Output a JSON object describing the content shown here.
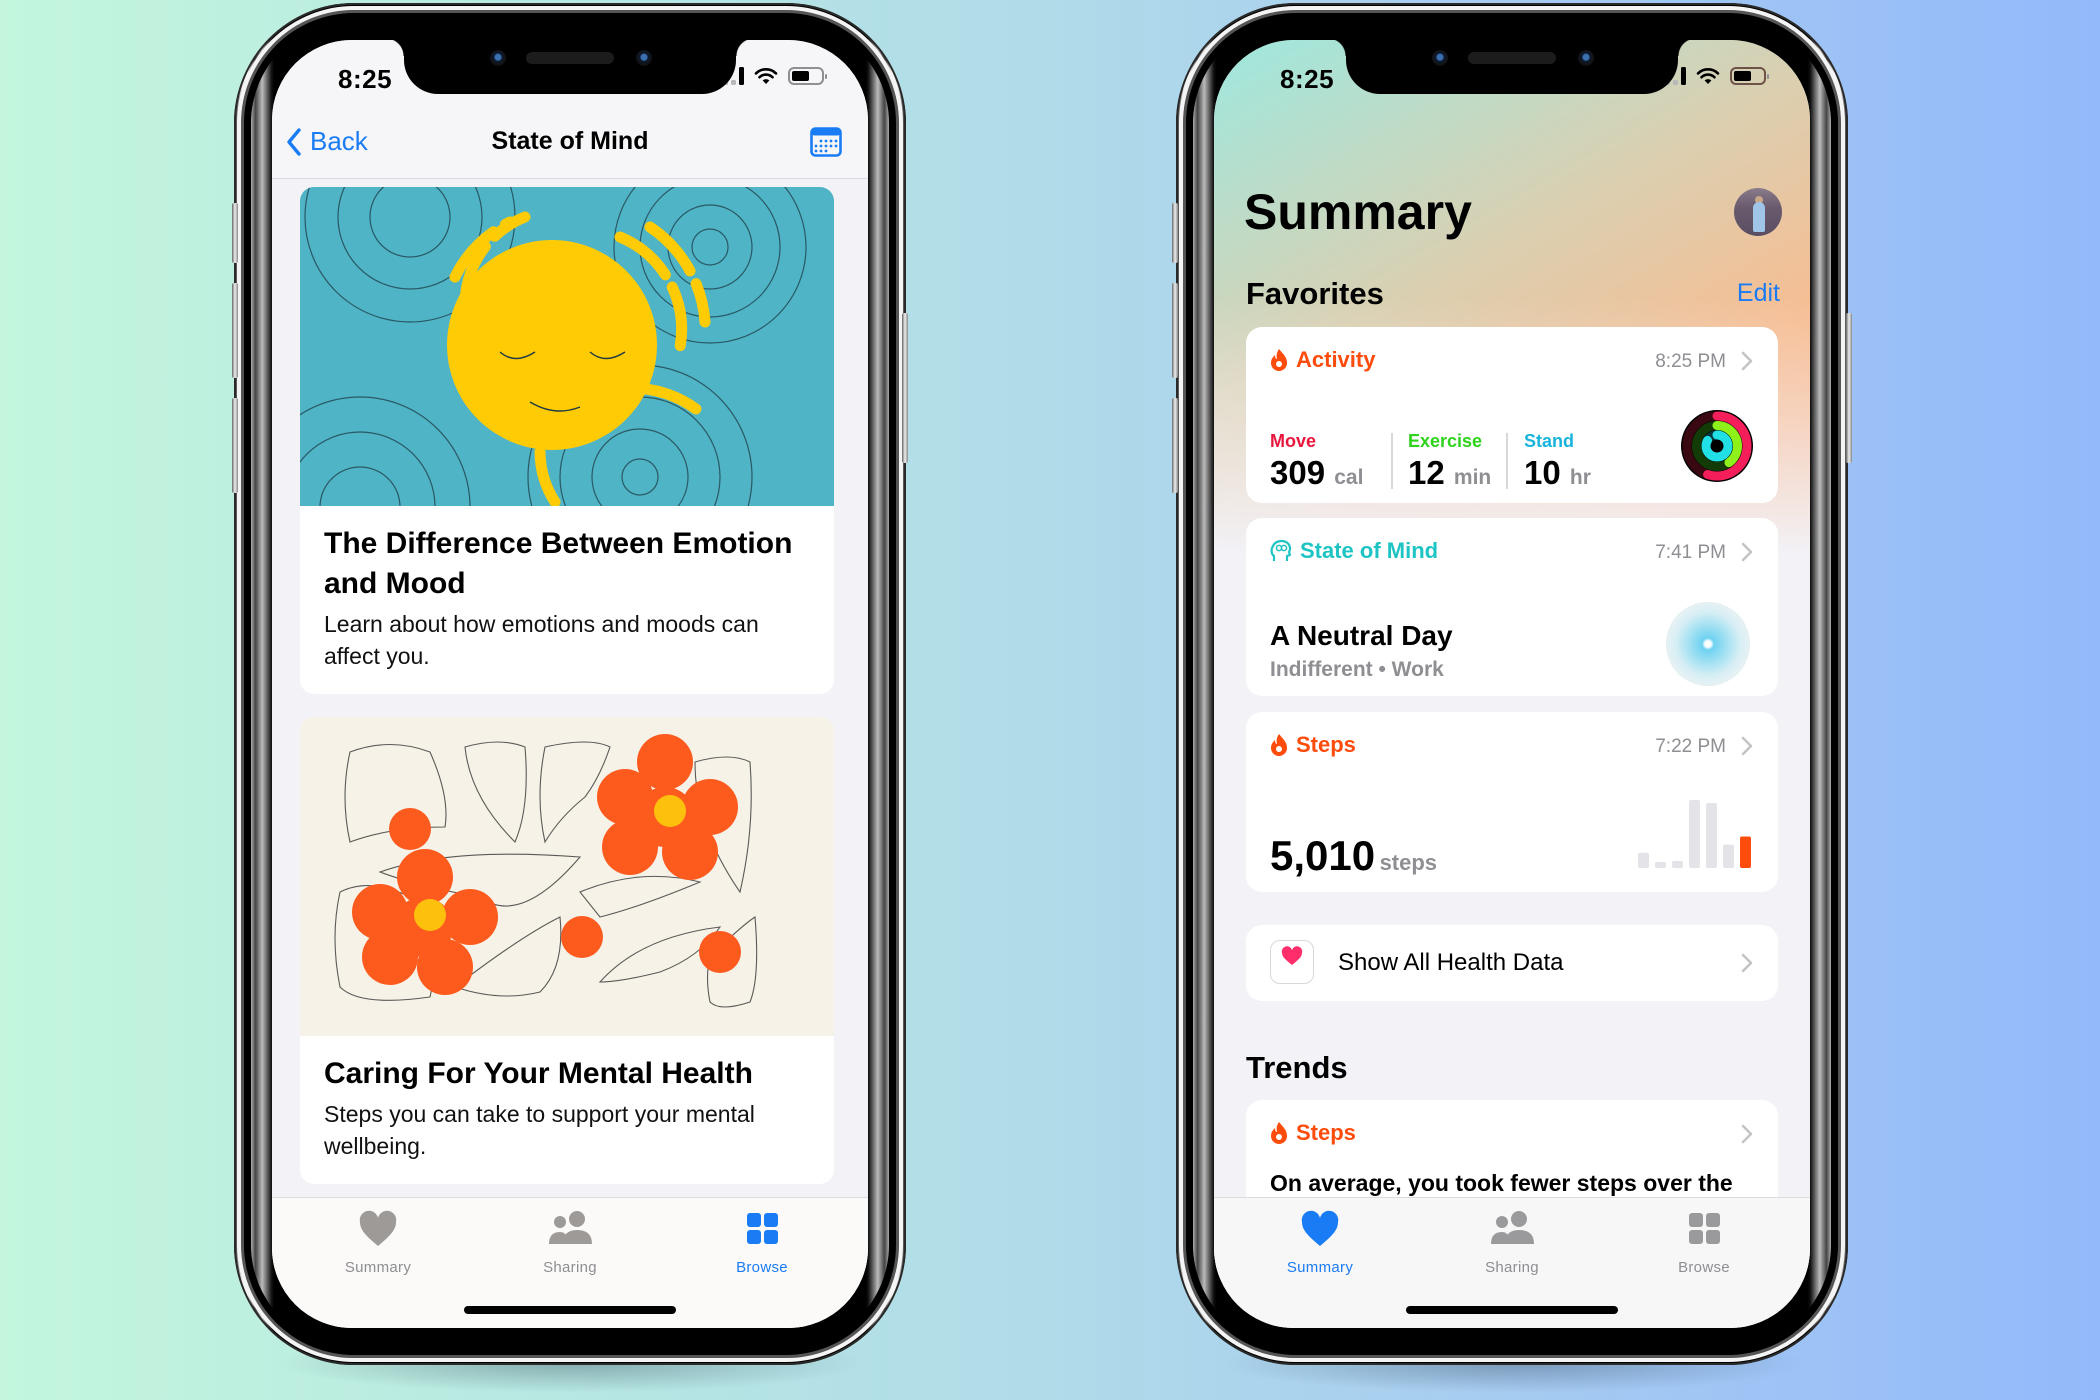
{
  "colors": {
    "accent_blue": "#1a7cf5",
    "activity_orange": "#fd4c0c",
    "move_red": "#e8163c",
    "exercise_green": "#2ed31c",
    "stand_cyan": "#19b4dc",
    "mind_teal": "#1ec4c4",
    "tab_gray": "#8e8e93"
  },
  "left_phone": {
    "status": {
      "time": "8:25",
      "signal_icon": "cellular-signal-icon",
      "wifi_icon": "wifi-icon",
      "battery_icon": "battery-icon",
      "battery_level": 0.6
    },
    "nav": {
      "back_label": "Back",
      "title": "State of Mind",
      "calendar_icon": "calendar-icon"
    },
    "articles": [
      {
        "title": "The Difference Between Emotion and Mood",
        "description": "Learn about how emotions and moods can affect you.",
        "illustration": "sleeping-sun-ripples-illustration"
      },
      {
        "title": "Caring For Your Mental Health",
        "description": "Steps you can take to support your mental wellbeing.",
        "illustration": "orange-flowers-illustration"
      }
    ],
    "tabs": [
      {
        "label": "Summary",
        "icon": "heart-icon",
        "active": false
      },
      {
        "label": "Sharing",
        "icon": "people-icon",
        "active": false
      },
      {
        "label": "Browse",
        "icon": "grid-icon",
        "active": true
      }
    ]
  },
  "right_phone": {
    "status": {
      "time": "8:25",
      "battery_level": 0.6
    },
    "title": "Summary",
    "favorites": {
      "heading": "Favorites",
      "edit_label": "Edit"
    },
    "activity": {
      "label": "Activity",
      "time": "8:25 PM",
      "move": {
        "label": "Move",
        "value": "309",
        "unit": "cal"
      },
      "exercise": {
        "label": "Exercise",
        "value": "12",
        "unit": "min"
      },
      "stand": {
        "label": "Stand",
        "value": "10",
        "unit": "hr"
      },
      "rings": {
        "move_progress": 0.55,
        "exercise_progress": 0.4,
        "stand_progress": 0.83
      }
    },
    "state_of_mind": {
      "label": "State of Mind",
      "time": "7:41 PM",
      "title": "A Neutral Day",
      "subtitle": "Indifferent • Work"
    },
    "steps": {
      "label": "Steps",
      "time": "7:22 PM",
      "value": "5,010",
      "unit": "steps",
      "bars": [
        15,
        6,
        7,
        67,
        64,
        23,
        31
      ]
    },
    "show_all": {
      "label": "Show All Health Data"
    },
    "trends": {
      "heading": "Trends",
      "card_label": "Steps",
      "card_text": "On average, you took fewer steps over the"
    },
    "tabs": [
      {
        "label": "Summary",
        "icon": "heart-icon",
        "active": true
      },
      {
        "label": "Sharing",
        "icon": "people-icon",
        "active": false
      },
      {
        "label": "Browse",
        "icon": "grid-icon",
        "active": false
      }
    ]
  }
}
